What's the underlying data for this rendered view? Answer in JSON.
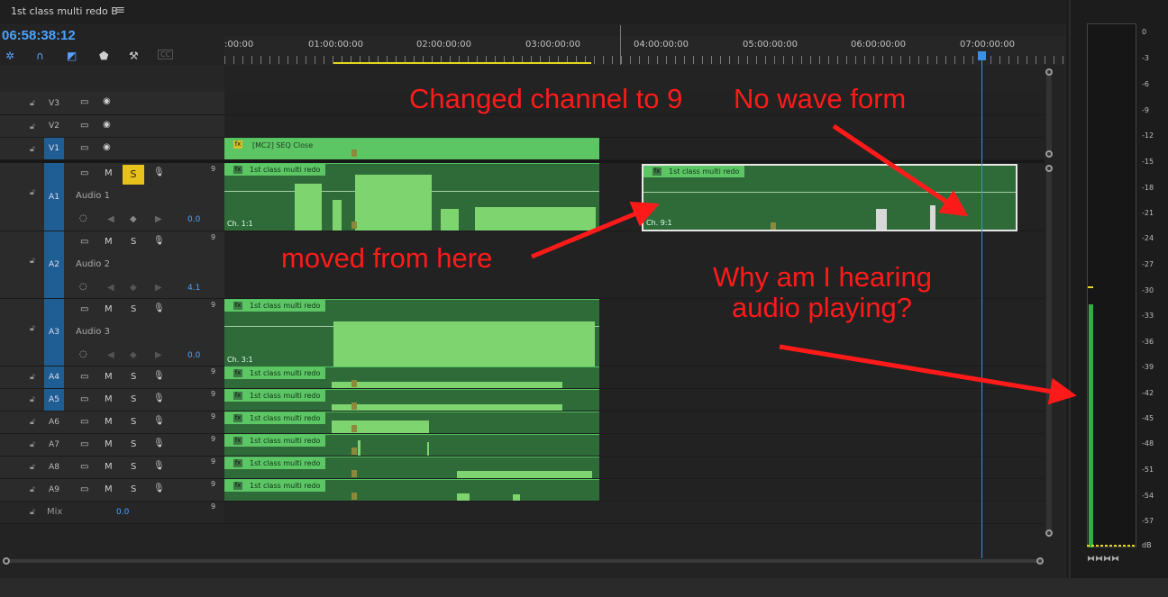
{
  "sequence": {
    "tab_title": "1st class multi redo B",
    "menu_icon": "hamburger-icon",
    "timecode": "06:58:38:12"
  },
  "toolbar": {
    "icons": [
      "snap-icon",
      "magnet-icon",
      "linked-selection-icon",
      "marker-icon",
      "wrench-icon",
      "captions-icon"
    ],
    "captions": "CC"
  },
  "ruler": {
    "labels": [
      ":00:00",
      "01:00:00:00",
      "02:00:00:00",
      "03:00:00:00",
      "04:00:00:00",
      "05:00:00:00",
      "06:00:00:00",
      "07:00:00:00"
    ]
  },
  "tracks": {
    "v3": {
      "label": "V3"
    },
    "v2": {
      "label": "V2"
    },
    "v1": {
      "label": "V1"
    },
    "a1": {
      "label": "A1",
      "name": "Audio 1",
      "volume": "0.0",
      "channels": "9"
    },
    "a2": {
      "label": "A2",
      "name": "Audio 2",
      "volume": "4.1",
      "channels": "9"
    },
    "a3": {
      "label": "A3",
      "name": "Audio 3",
      "volume": "0.0",
      "channels": "9"
    },
    "a4": {
      "label": "A4",
      "channels": "9"
    },
    "a5": {
      "label": "A5",
      "channels": "9"
    },
    "a6": {
      "label": "A6",
      "channels": "9"
    },
    "a7": {
      "label": "A7",
      "channels": "9"
    },
    "a8": {
      "label": "A8",
      "channels": "9"
    },
    "a9": {
      "label": "A9",
      "channels": "9"
    },
    "mix": {
      "label": "Mix",
      "volume": "0.0",
      "channels": "9"
    }
  },
  "buttons": {
    "mute": "M",
    "solo": "S"
  },
  "clips": {
    "v1": {
      "name": "[MC2] SEQ Close",
      "fx": "fx"
    },
    "audio_name": "1st class multi redo",
    "a1_channel": "Ch. 1:1",
    "a1_moved_channel": "Ch. 9:1",
    "a3_channel": "Ch. 3:1"
  },
  "annotations": {
    "changed": "Changed channel to 9",
    "nowave": "No wave form",
    "moved": "moved from here",
    "why_line1": "Why am I hearing",
    "why_line2": "audio playing?",
    "color": "#ff1a1a"
  },
  "meter": {
    "scale": [
      "0",
      "-3",
      "-6",
      "-9",
      "-12",
      "-15",
      "-18",
      "-21",
      "-24",
      "-27",
      "-30",
      "-33",
      "-36",
      "-39",
      "-42",
      "-45",
      "-48",
      "-51",
      "-54",
      "-57",
      "dB"
    ],
    "level_db": -32
  }
}
